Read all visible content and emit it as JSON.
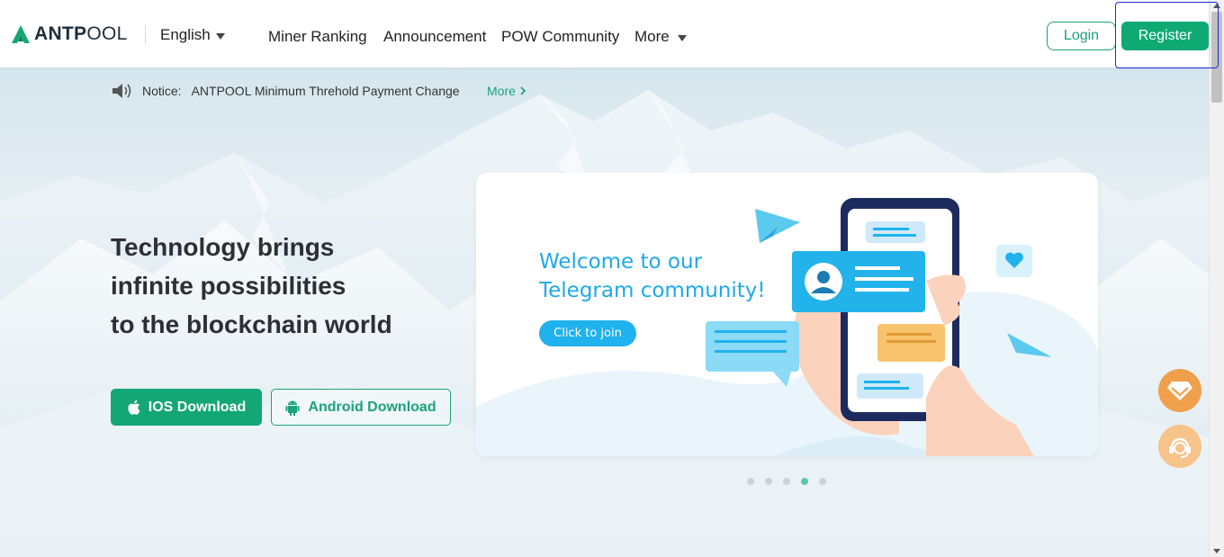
{
  "header": {
    "logo": "ANTPOOL",
    "language": "English",
    "nav": [
      {
        "label": "Miner Ranking"
      },
      {
        "label": "Announcement"
      },
      {
        "label": "POW Community"
      },
      {
        "label": "More"
      }
    ],
    "login_label": "Login",
    "register_label": "Register"
  },
  "notice": {
    "label": "Notice:",
    "text": "ANTPOOL Minimum Threhold Payment Change",
    "more_label": "More"
  },
  "hero": {
    "headline": [
      "Technology brings",
      "infinite possibilities",
      "to the blockchain world"
    ],
    "ios_label": "IOS Download",
    "android_label": "Android Download"
  },
  "banner": {
    "title_line1": "Welcome to our",
    "title_line2": "Telegram community!",
    "button_label": "Click to join",
    "slides_total": 5,
    "active_slide": 4
  },
  "colors": {
    "brand_green": "#0faa74",
    "telegram_blue": "#1fb2ee",
    "annotation_blue": "#1f2bd6"
  },
  "icons": [
    "antpool-logo-icon",
    "chevron-down-icon",
    "speaker-icon",
    "chevron-right-icon",
    "apple-icon",
    "android-icon",
    "vip-diamond-icon",
    "support-headset-icon"
  ]
}
